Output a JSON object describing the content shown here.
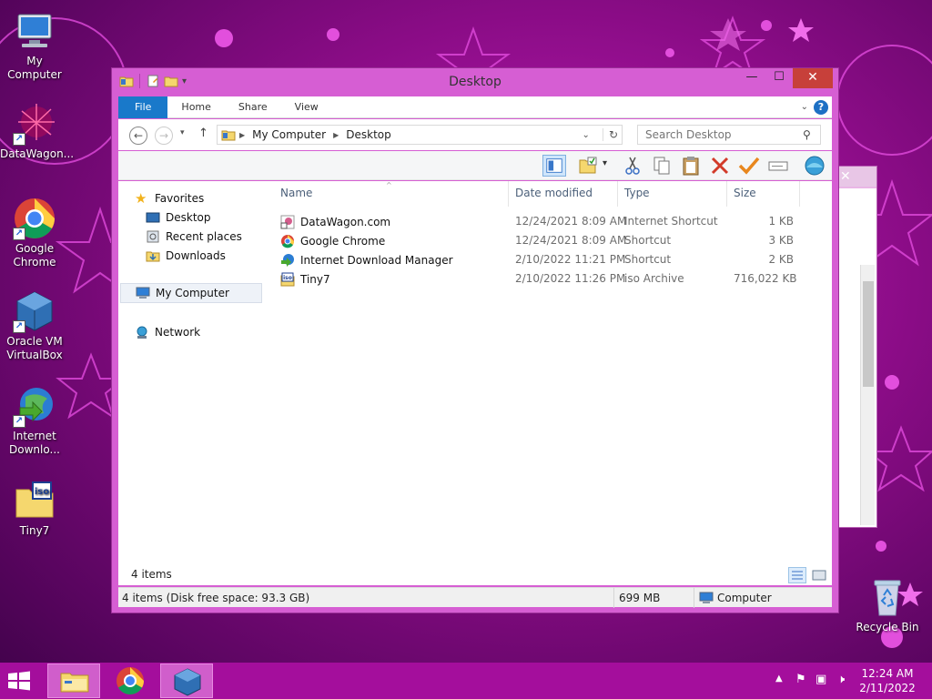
{
  "colors": {
    "accent_file_tab": "#1979ca",
    "window_frame": "#d65ed3",
    "close_button": "#c7403a",
    "taskbar": "#a40e9c"
  },
  "desktop": {
    "icons": [
      {
        "label": "My Computer",
        "icon": "computer-icon"
      },
      {
        "label": "DataWagon...",
        "icon": "web-shortcut-icon"
      },
      {
        "label": "Google Chrome",
        "icon": "chrome-icon"
      },
      {
        "label": "Oracle VM VirtualBox",
        "icon": "virtualbox-icon"
      },
      {
        "label": "Internet Downlo...",
        "icon": "idm-icon"
      },
      {
        "label": "Tiny7",
        "icon": "iso-file-icon"
      },
      {
        "label": "Recycle Bin",
        "icon": "recycle-bin-icon"
      }
    ]
  },
  "window": {
    "title": "Desktop",
    "controls": {
      "minimize": "—",
      "maximize": "☐",
      "close": "✕"
    },
    "ribbon_tabs": [
      "File",
      "Home",
      "Share",
      "View"
    ],
    "help": "?",
    "address": {
      "segments": [
        "My Computer",
        "Desktop"
      ]
    },
    "search": {
      "placeholder": "Search Desktop"
    },
    "nav": {
      "favorites": "Favorites",
      "favorite_items": [
        "Desktop",
        "Recent places",
        "Downloads"
      ],
      "computer": "My Computer",
      "network": "Network"
    },
    "columns": [
      "Name",
      "Date modified",
      "Type",
      "Size"
    ],
    "files": [
      {
        "name": "DataWagon.com",
        "date": "12/24/2021 8:09 AM",
        "type": "Internet Shortcut",
        "size": "1 KB",
        "icon": "web-shortcut-icon"
      },
      {
        "name": "Google Chrome",
        "date": "12/24/2021 8:09 AM",
        "type": "Shortcut",
        "size": "3 KB",
        "icon": "chrome-icon"
      },
      {
        "name": "Internet Download Manager",
        "date": "2/10/2022 11:21 PM",
        "type": "Shortcut",
        "size": "2 KB",
        "icon": "idm-icon"
      },
      {
        "name": "Tiny7",
        "date": "2/10/2022 11:26 PM",
        "type": "iso Archive",
        "size": "716,022 KB",
        "icon": "iso-file-icon"
      }
    ],
    "item_count": "4 items",
    "status": {
      "left": "4 items (Disk free space: 93.3 GB)",
      "middle": "699 MB",
      "right": "Computer"
    }
  },
  "taskbar": {
    "clock_time": "12:24 AM",
    "clock_date": "2/11/2022"
  }
}
